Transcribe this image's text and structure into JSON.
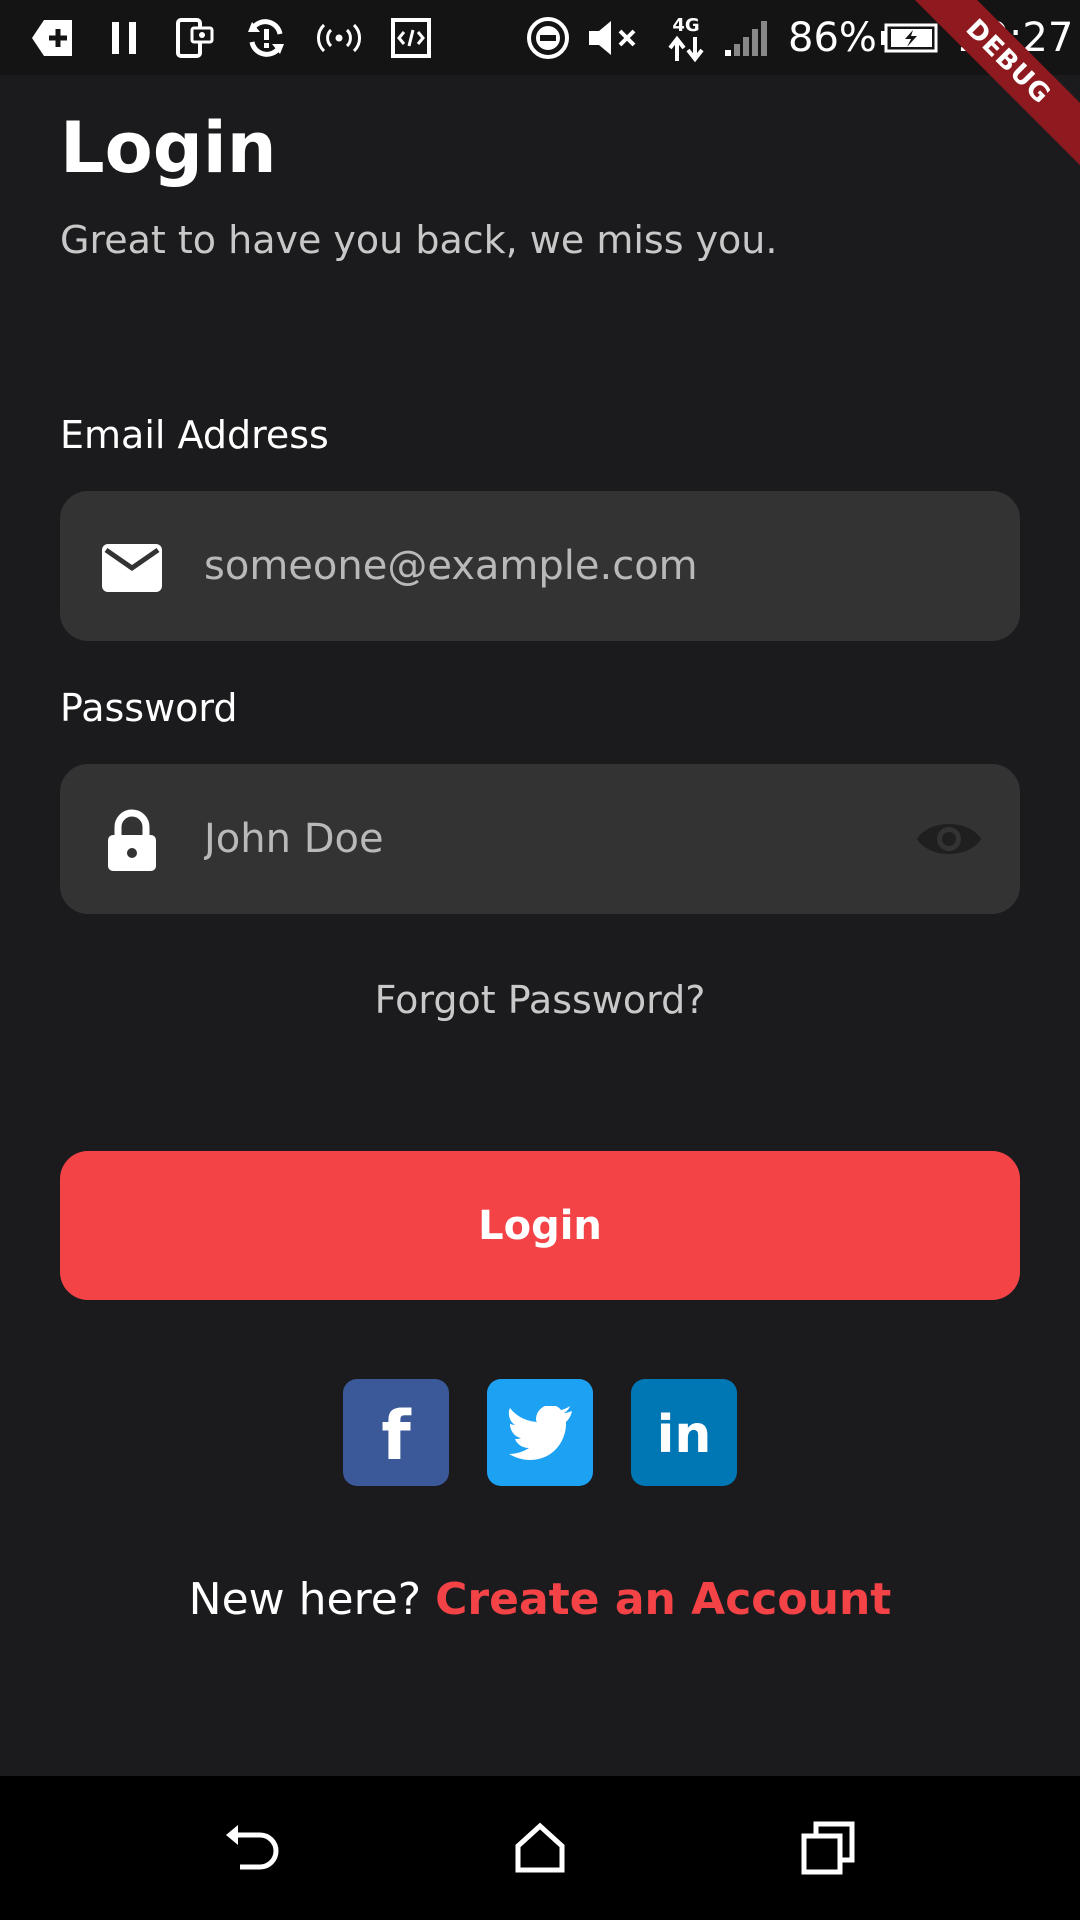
{
  "status_bar": {
    "battery_percent": "86%",
    "time": "20:27",
    "network_type": "4G",
    "icons": [
      "add-notification-icon",
      "pause-icon",
      "screenshot-icon",
      "sync-icon",
      "hotspot-icon",
      "developer-icon",
      "do-not-disturb-icon",
      "mute-icon",
      "network-4g-icon",
      "signal-icon",
      "battery-charging-icon"
    ]
  },
  "debug_banner": "DEBUG",
  "header": {
    "title": "Login",
    "subtitle": "Great to have you back, we miss you."
  },
  "form": {
    "email": {
      "label": "Email Address",
      "placeholder": "someone@example.com",
      "value": "",
      "icon": "mail-icon"
    },
    "password": {
      "label": "Password",
      "placeholder": "John Doe",
      "value": "",
      "icon": "lock-icon",
      "toggle_icon": "eye-icon"
    },
    "forgot_password": "Forgot Password?",
    "submit_label": "Login"
  },
  "social": [
    {
      "name": "facebook",
      "label": "f",
      "color": "#3b5998"
    },
    {
      "name": "twitter",
      "label": "",
      "color": "#1da1f2"
    },
    {
      "name": "linkedin",
      "label": "in",
      "color": "#0077b5"
    }
  ],
  "signup": {
    "prompt": "New here? ",
    "link": "Create an Account"
  },
  "nav_bar": {
    "icons": [
      "back-icon",
      "home-icon",
      "recents-icon"
    ]
  },
  "colors": {
    "background": "#1b1b1d",
    "field_background": "#333334",
    "accent": "#f44347",
    "debug_banner": "#8e1a1f"
  }
}
